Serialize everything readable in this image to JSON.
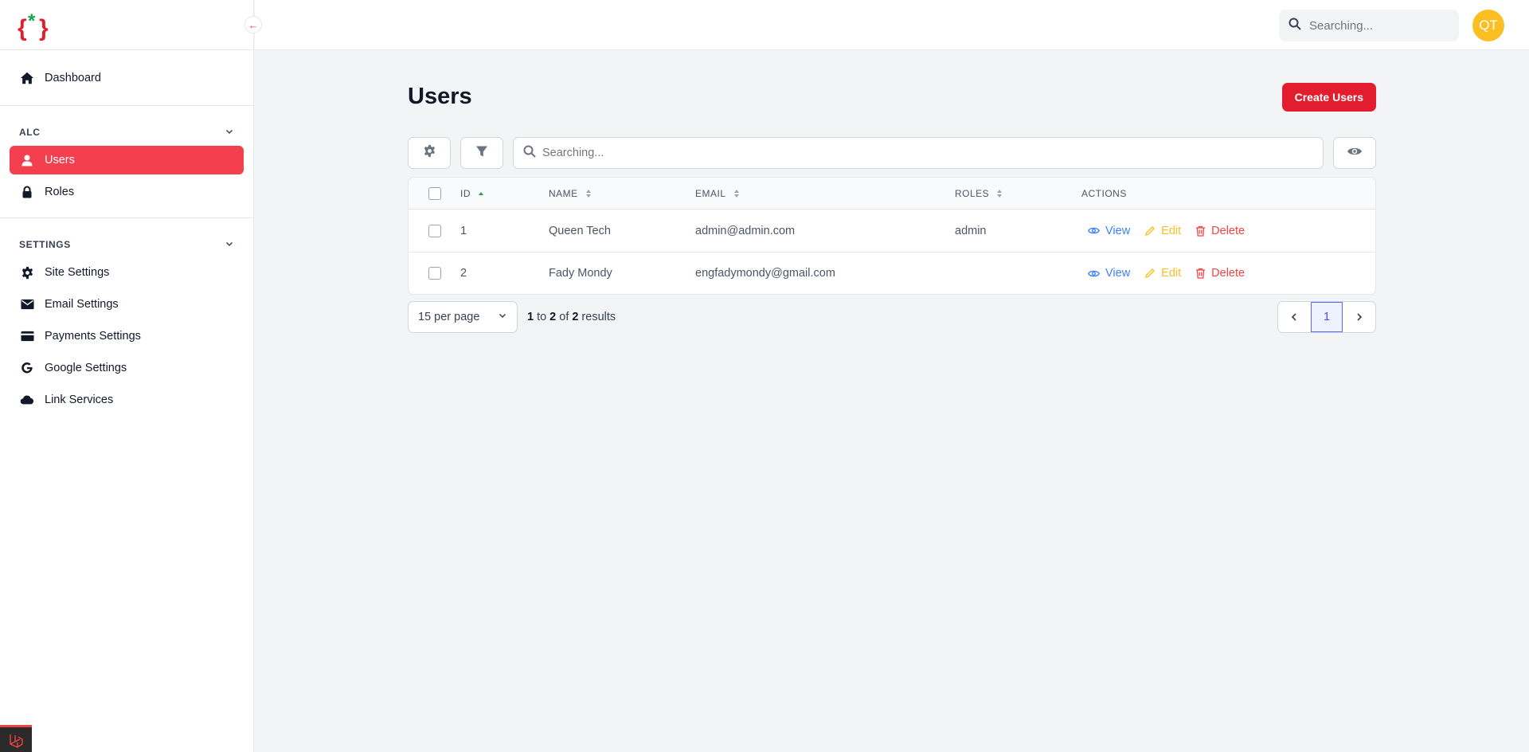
{
  "colors": {
    "accent": "#e11d2e",
    "active_nav": "#f43f4f",
    "avatar": "#fbbf24",
    "view": "#3b82f6",
    "edit": "#fbbf24",
    "delete": "#ef4444"
  },
  "sidebar": {
    "logo_icon": "curly-braces-asterisk-logo",
    "collapse_icon": "arrow-left-icon",
    "dashboard": {
      "label": "Dashboard",
      "icon": "home-icon"
    },
    "sections": [
      {
        "title": "ALC",
        "items": [
          {
            "label": "Users",
            "icon": "user-icon",
            "active": true
          },
          {
            "label": "Roles",
            "icon": "lock-icon"
          }
        ]
      },
      {
        "title": "SETTINGS",
        "items": [
          {
            "label": "Site Settings",
            "icon": "gear-icon"
          },
          {
            "label": "Email Settings",
            "icon": "mail-icon"
          },
          {
            "label": "Payments Settings",
            "icon": "credit-card-icon"
          },
          {
            "label": "Google Settings",
            "icon": "google-icon"
          },
          {
            "label": "Link Services",
            "icon": "cloud-icon"
          }
        ]
      }
    ]
  },
  "topbar": {
    "search_placeholder": "Searching...",
    "avatar_initials": "QT"
  },
  "main": {
    "title": "Users",
    "create_label": "Create Users",
    "table_search_placeholder": "Searching...",
    "columns": {
      "id": "ID",
      "name": "NAME",
      "email": "EMAIL",
      "roles": "ROLES",
      "actions": "ACTIONS"
    },
    "rows": [
      {
        "id": "1",
        "name": "Queen Tech",
        "email": "admin@admin.com",
        "roles": "admin"
      },
      {
        "id": "2",
        "name": "Fady Mondy",
        "email": "engfadymondy@gmail.com",
        "roles": ""
      }
    ],
    "actions": {
      "view": "View",
      "edit": "Edit",
      "delete": "Delete"
    },
    "per_page": "15 per page",
    "results": {
      "from": "1",
      "to_word": "to",
      "to": "2",
      "of_word": "of",
      "total": "2",
      "suffix": "results"
    },
    "current_page": "1"
  }
}
